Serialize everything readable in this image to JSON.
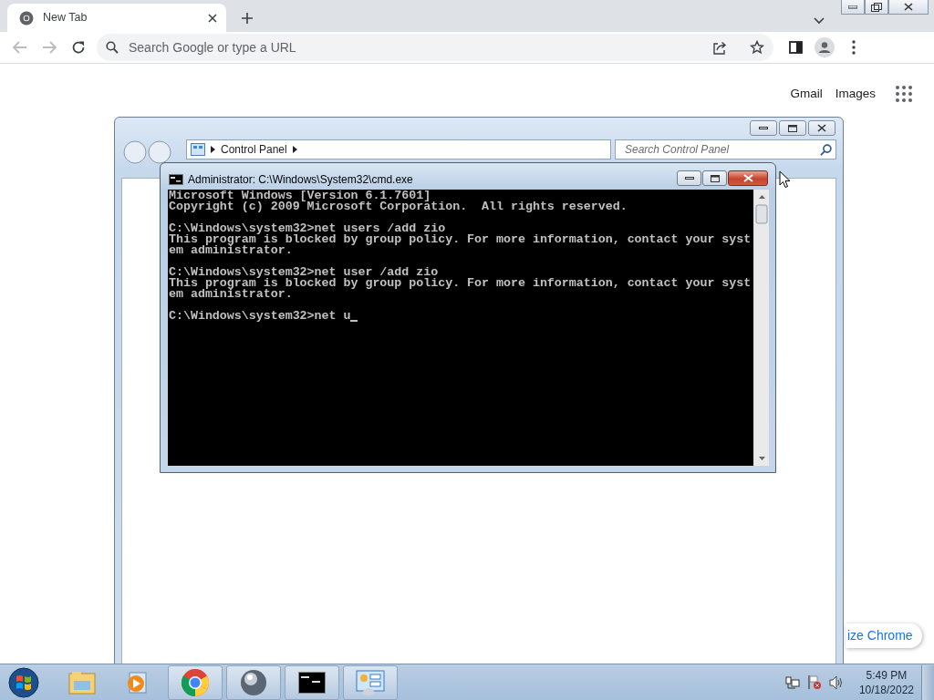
{
  "browser": {
    "tab": {
      "title": "New Tab"
    },
    "omnibox": {
      "placeholder": "Search Google or type a URL"
    }
  },
  "newtab": {
    "links": [
      "Gmail",
      "Images"
    ],
    "customize_button": "ize Chrome"
  },
  "control_panel": {
    "address": "Control Panel",
    "search": {
      "placeholder": "Search Control Panel"
    }
  },
  "cmd": {
    "title": "Administrator: C:\\Windows\\System32\\cmd.exe",
    "blocks": [
      [
        "Microsoft Windows [Version 6.1.7601]",
        "Copyright (c) 2009 Microsoft Corporation.  All rights reserved."
      ],
      [
        "C:\\Windows\\system32>net users /add zio",
        "This program is blocked by group policy. For more information, contact your syst",
        "em administrator."
      ],
      [
        "C:\\Windows\\system32>net user /add zio",
        "This program is blocked by group policy. For more information, contact your syst",
        "em administrator."
      ]
    ],
    "input": "C:\\Windows\\system32>net u"
  },
  "taskbar": {
    "time": "5:49 PM",
    "date": "10/18/2022"
  }
}
